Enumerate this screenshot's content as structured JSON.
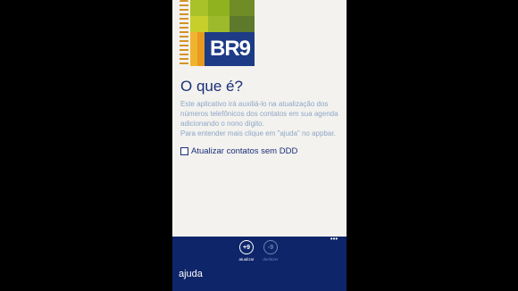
{
  "logo": {
    "text": "BR9"
  },
  "header": {
    "title": "O que é?"
  },
  "description": {
    "lines": [
      "Este aplicativo irá auxiliá-lo na atualização dos",
      "números telefônicos dos contatos em sua agenda",
      "adicionando o nono dígito.",
      "Para entender mais clique em \"ajuda\" no appbar."
    ]
  },
  "option": {
    "label": "Atualizar contatos sem DDD",
    "checked": false
  },
  "appbar": {
    "buttons": [
      {
        "icon": "+9",
        "label": "atualizar"
      },
      {
        "icon": "-9",
        "label": "desfazer"
      }
    ],
    "more": "•••",
    "menu_item": "ajuda"
  },
  "colors": {
    "accent": "#1b2f7a",
    "appbar_bg": "#0e2569",
    "page_bg": "#f3f2ee",
    "logo_blue": "#1d3b86"
  }
}
